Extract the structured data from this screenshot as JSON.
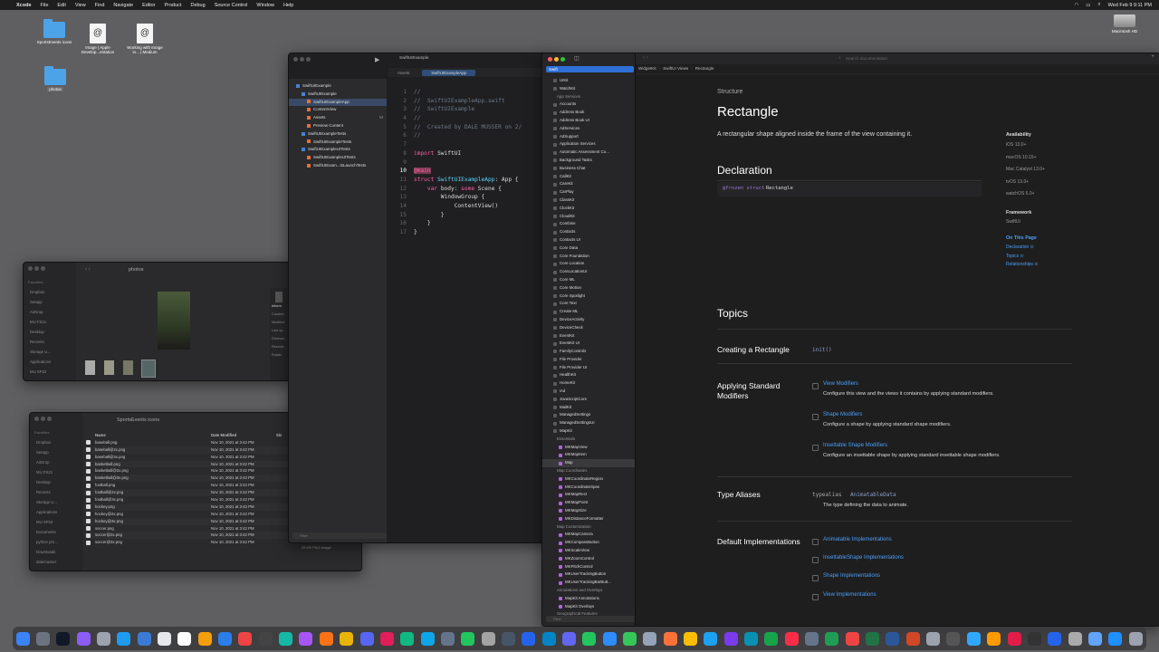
{
  "menubar": {
    "apple": "",
    "app": "Xcode",
    "items": [
      "File",
      "Edit",
      "View",
      "Find",
      "Navigate",
      "Editor",
      "Product",
      "Debug",
      "Source Control",
      "Window",
      "Help"
    ],
    "clock": "Wed Feb 9  9:11 PM"
  },
  "desktop": {
    "icons": [
      {
        "label": "SportsEvents icons",
        "kind": "folder"
      },
      {
        "label": "Image | Apple Develop...entation",
        "kind": "doc"
      },
      {
        "label": "Working with Image in... | Medium",
        "kind": "doc"
      },
      {
        "label": "photos",
        "kind": "folder"
      },
      {
        "label": "Macintosh HD",
        "kind": "drive"
      }
    ]
  },
  "photos_window": {
    "title": "photos",
    "sidebar_header": "Favorites",
    "sidebar": [
      "Dropbox",
      "Setapp",
      "AirDrop",
      "MU FS21",
      "Desktop",
      "Recents",
      "Storage U...",
      "Applications",
      "MU SP22"
    ],
    "info": [
      "Inform",
      "Created",
      "Modified",
      "Last op...",
      "Dimensi...",
      "Resolut...",
      "Rotate"
    ]
  },
  "finder_window": {
    "title": "SportsEvents icons",
    "sidebar_header": "Favorites",
    "sidebar": [
      "Dropbox",
      "Setapp",
      "AirDrop",
      "MU FS21",
      "Desktop",
      "Recents",
      "Storage U...",
      "Applications",
      "MU SP22",
      "Documents",
      "python pro...",
      "Downloads",
      "dalemusser"
    ],
    "columns": [
      "Name",
      "Date Modified",
      "Siz"
    ],
    "rows": [
      [
        "baseball.png",
        "Nov 10, 2021 at 3:42 PM"
      ],
      [
        "baseball@2x.png",
        "Nov 10, 2021 at 3:42 PM"
      ],
      [
        "baseball@3x.png",
        "Nov 10, 2021 at 3:42 PM"
      ],
      [
        "basketball.png",
        "Nov 10, 2021 at 3:42 PM"
      ],
      [
        "basketball@2x.png",
        "Nov 10, 2021 at 3:42 PM"
      ],
      [
        "basketball@3x.png",
        "Nov 10, 2021 at 3:42 PM"
      ],
      [
        "football.png",
        "Nov 10, 2021 at 3:42 PM"
      ],
      [
        "football@2x.png",
        "Nov 10, 2021 at 3:42 PM"
      ],
      [
        "football@3x.png",
        "Nov 10, 2021 at 3:42 PM"
      ],
      [
        "hockey.png",
        "Nov 10, 2021 at 3:42 PM"
      ],
      [
        "hockey@2x.png",
        "Nov 10, 2021 at 3:42 PM"
      ],
      [
        "hockey@3x.png",
        "Nov 10, 2021 at 3:42 PM"
      ],
      [
        "soccer.png",
        "Nov 10, 2021 at 3:42 PM"
      ],
      [
        "soccer@2x.png",
        "Nov 10, 2021 at 3:42 PM"
      ],
      [
        "soccer@3x.png",
        "Nov 10, 2021 at 3:42 PM"
      ]
    ],
    "status": "25 KB   PNG image"
  },
  "xcode": {
    "project_title": "SwiftUIExample",
    "tabs": [
      "Assets",
      "SwiftUIExampleApp"
    ],
    "navigator": [
      {
        "label": "SwiftUIExample",
        "indent": 0
      },
      {
        "label": "SwiftUIExample",
        "indent": 1
      },
      {
        "label": "SwiftUIExampleApp",
        "indent": 2,
        "selected": true
      },
      {
        "label": "ContentView",
        "indent": 2
      },
      {
        "label": "Assets",
        "indent": 2,
        "badge": "M"
      },
      {
        "label": "Preview Content",
        "indent": 2
      },
      {
        "label": "SwiftUIExampleTests",
        "indent": 1
      },
      {
        "label": "SwiftUIExampleTests",
        "indent": 2
      },
      {
        "label": "SwiftUIExampleUITests",
        "indent": 1
      },
      {
        "label": "SwiftUIExampleUITests",
        "indent": 2
      },
      {
        "label": "SwiftUIExam...tsLaunchTests",
        "indent": 2
      }
    ],
    "filter": "Filter",
    "code": [
      {
        "n": "1",
        "parts": [
          [
            "cm",
            "//"
          ]
        ]
      },
      {
        "n": "2",
        "parts": [
          [
            "cm",
            "//  SwiftUIExampleApp.swift"
          ]
        ]
      },
      {
        "n": "3",
        "parts": [
          [
            "cm",
            "//  SwiftUIExample"
          ]
        ]
      },
      {
        "n": "4",
        "parts": [
          [
            "cm",
            "//"
          ]
        ]
      },
      {
        "n": "5",
        "parts": [
          [
            "cm",
            "//  Created by DALE MUSSER on 2/"
          ]
        ]
      },
      {
        "n": "6",
        "parts": [
          [
            "cm",
            "//"
          ]
        ]
      },
      {
        "n": "7",
        "parts": []
      },
      {
        "n": "8",
        "parts": [
          [
            "kw",
            "import"
          ],
          [
            "pl",
            " SwiftUI"
          ]
        ]
      },
      {
        "n": "9",
        "parts": []
      },
      {
        "n": "10",
        "parts": [
          [
            "kw",
            "@main"
          ]
        ]
      },
      {
        "n": "11",
        "parts": [
          [
            "kw",
            "struct"
          ],
          [
            "pl",
            " "
          ],
          [
            "ty",
            "SwiftUIExampleApp"
          ],
          [
            "pl",
            ": App {"
          ]
        ]
      },
      {
        "n": "12",
        "parts": [
          [
            "pl",
            "    "
          ],
          [
            "kw",
            "var"
          ],
          [
            "pl",
            " body: "
          ],
          [
            "kw",
            "some"
          ],
          [
            "pl",
            " Scene {"
          ]
        ]
      },
      {
        "n": "13",
        "parts": [
          [
            "pl",
            "        WindowGroup {"
          ]
        ]
      },
      {
        "n": "14",
        "parts": [
          [
            "pl",
            "            ContentView()"
          ]
        ]
      },
      {
        "n": "15",
        "parts": [
          [
            "pl",
            "        }"
          ]
        ]
      },
      {
        "n": "16",
        "parts": [
          [
            "pl",
            "    }"
          ]
        ]
      },
      {
        "n": "17",
        "parts": [
          [
            "pl",
            "}"
          ]
        ]
      }
    ]
  },
  "docs": {
    "search_scope": "Swift",
    "search_placeholder": "Search documentation",
    "breadcrumb": [
      "WidgetKit",
      "SwiftUI Views",
      "Rectangle"
    ],
    "nav": [
      {
        "label": "UIKit",
        "t": "i"
      },
      {
        "label": "WatchKit",
        "t": "i"
      },
      {
        "label": "App Services",
        "t": "h"
      },
      {
        "label": "Accounts",
        "t": "i"
      },
      {
        "label": "Address Book",
        "t": "i"
      },
      {
        "label": "Address Book UI",
        "t": "i"
      },
      {
        "label": "AdServices",
        "t": "i"
      },
      {
        "label": "AdSupport",
        "t": "i"
      },
      {
        "label": "Application Services",
        "t": "i"
      },
      {
        "label": "Automatic Assessment Co...",
        "t": "i"
      },
      {
        "label": "Background Tasks",
        "t": "i"
      },
      {
        "label": "Business Chat",
        "t": "i"
      },
      {
        "label": "CallKit",
        "t": "i"
      },
      {
        "label": "CareKit",
        "t": "i"
      },
      {
        "label": "CarPlay",
        "t": "i"
      },
      {
        "label": "ClassKit",
        "t": "i"
      },
      {
        "label": "ClockKit",
        "t": "i"
      },
      {
        "label": "CloudKit",
        "t": "i"
      },
      {
        "label": "Combine",
        "t": "i"
      },
      {
        "label": "Contacts",
        "t": "i"
      },
      {
        "label": "Contacts UI",
        "t": "i"
      },
      {
        "label": "Core Data",
        "t": "i"
      },
      {
        "label": "Core Foundation",
        "t": "i"
      },
      {
        "label": "Core Location",
        "t": "i"
      },
      {
        "label": "CoreLocationUI",
        "t": "i"
      },
      {
        "label": "Core ML",
        "t": "i"
      },
      {
        "label": "Core Motion",
        "t": "i"
      },
      {
        "label": "Core Spotlight",
        "t": "i"
      },
      {
        "label": "Core Text",
        "t": "i"
      },
      {
        "label": "Create ML",
        "t": "i"
      },
      {
        "label": "DeviceActivity",
        "t": "i"
      },
      {
        "label": "DeviceCheck",
        "t": "i"
      },
      {
        "label": "EventKit",
        "t": "i"
      },
      {
        "label": "EventKit UI",
        "t": "i"
      },
      {
        "label": "FamilyControls",
        "t": "i"
      },
      {
        "label": "File Provider",
        "t": "i"
      },
      {
        "label": "File Provider UI",
        "t": "i"
      },
      {
        "label": "HealthKit",
        "t": "i"
      },
      {
        "label": "HomeKit",
        "t": "i"
      },
      {
        "label": "iAd",
        "t": "i"
      },
      {
        "label": "JavaScriptCore",
        "t": "i"
      },
      {
        "label": "MailKit",
        "t": "i"
      },
      {
        "label": "ManagedSettings",
        "t": "i"
      },
      {
        "label": "ManagedSettingsUI",
        "t": "i"
      },
      {
        "label": "MapKit",
        "t": "i"
      },
      {
        "label": "Essentials",
        "t": "h2"
      },
      {
        "label": "MKMapView",
        "t": "s"
      },
      {
        "label": "MKMapItem",
        "t": "s"
      },
      {
        "label": "Map",
        "t": "s",
        "selected": true
      },
      {
        "label": "Map Coordinates",
        "t": "h2"
      },
      {
        "label": "MKCoordinateRegion",
        "t": "s"
      },
      {
        "label": "MKCoordinateSpan",
        "t": "s"
      },
      {
        "label": "MKMapRect",
        "t": "s"
      },
      {
        "label": "MKMapPoint",
        "t": "s"
      },
      {
        "label": "MKMapSize",
        "t": "s"
      },
      {
        "label": "MKDistanceFormatter",
        "t": "s"
      },
      {
        "label": "Map Customization",
        "t": "h2"
      },
      {
        "label": "MKMapCamera",
        "t": "s"
      },
      {
        "label": "MKCompassButton",
        "t": "s"
      },
      {
        "label": "MKScaleView",
        "t": "s"
      },
      {
        "label": "MKZoomControl",
        "t": "s"
      },
      {
        "label": "MKPitchControl",
        "t": "s"
      },
      {
        "label": "MKUserTrackingButton",
        "t": "s"
      },
      {
        "label": "MKUserTrackingBarButt...",
        "t": "s"
      },
      {
        "label": "Annotations and Overlays",
        "t": "h2"
      },
      {
        "label": "MapKit Annotations",
        "t": "s"
      },
      {
        "label": "MapKit Overlays",
        "t": "s"
      },
      {
        "label": "Geographical Features",
        "t": "h2"
      }
    ],
    "nav_filter": "Filter",
    "kind": "Structure",
    "title": "Rectangle",
    "abstract": "A rectangular shape aligned inside the frame of the view containing it.",
    "declaration_heading": "Declaration",
    "declaration_attr": "@frozen struct",
    "declaration_name": "Rectangle",
    "availability_heading": "Availability",
    "availability": [
      "iOS 13.0+",
      "macOS 10.15+",
      "Mac Catalyst 13.0+",
      "tvOS 13.0+",
      "watchOS 6.0+"
    ],
    "framework_heading": "Framework",
    "framework": "SwiftUI",
    "on_this_page_heading": "On This Page",
    "on_this_page": [
      "Declaration ⊙",
      "Topics ⊙",
      "Relationships ⊙"
    ],
    "topics_heading": "Topics",
    "creating_heading": "Creating a Rectangle",
    "creating_init": "init()",
    "applying_heading": "Applying Standard Modifiers",
    "modifiers": [
      {
        "link": "View Modifiers",
        "desc": "Configure this view and the views it contains by applying standard modifiers."
      },
      {
        "link": "Shape Modifiers",
        "desc": "Configure a shape by applying standard shape modifiers."
      },
      {
        "link": "Insettable Shape Modifiers",
        "desc": "Configure an insettable shape by applying standard insettable shape modifiers."
      }
    ],
    "type_aliases_heading": "Type Aliases",
    "type_alias_kw": "typealias",
    "type_alias_name": "AnimatableData",
    "type_alias_desc": "The type defining the data to animate.",
    "default_impl_heading": "Default Implementations",
    "default_impls": [
      "Animatable Implementations",
      "InsettableShape Implementations",
      "Shape Implementations",
      "View Implementations"
    ]
  },
  "dock": {
    "apps": [
      "finder-icon",
      "launchpad-icon",
      "terminal-icon",
      "app-icon",
      "screenshot-icon",
      "app-store-icon",
      "xcode-icon",
      "app-icon",
      "notion-icon",
      "app-icon",
      "vscode-icon",
      "app-icon",
      "typora-icon",
      "app-icon",
      "app-icon",
      "vlc-icon",
      "app-icon",
      "discord-icon",
      "slack-icon",
      "app-icon",
      "app-icon",
      "app-icon",
      "app-icon",
      "app-icon",
      "app-icon",
      "app-icon",
      "app-icon",
      "app-icon",
      "facetime-icon",
      "zoom-icon",
      "messages-icon",
      "app-icon",
      "firefox-icon",
      "chrome-icon",
      "safari-icon",
      "app-icon",
      "app-icon",
      "app-icon",
      "music-icon",
      "app-icon",
      "numbers-icon",
      "app-icon",
      "excel-icon",
      "word-icon",
      "powerpoint-icon",
      "app-icon",
      "app-icon",
      "photoshop-icon",
      "illustrator-icon",
      "acrobat-icon",
      "app-icon",
      "app-icon",
      "app-icon",
      "app-icon",
      "finder-icon",
      "trash-icon"
    ]
  },
  "colors": {
    "accent": "#4b9ff8",
    "keyword": "#fc5fa3",
    "comment": "#6c7986",
    "type": "#5dd8ff"
  }
}
